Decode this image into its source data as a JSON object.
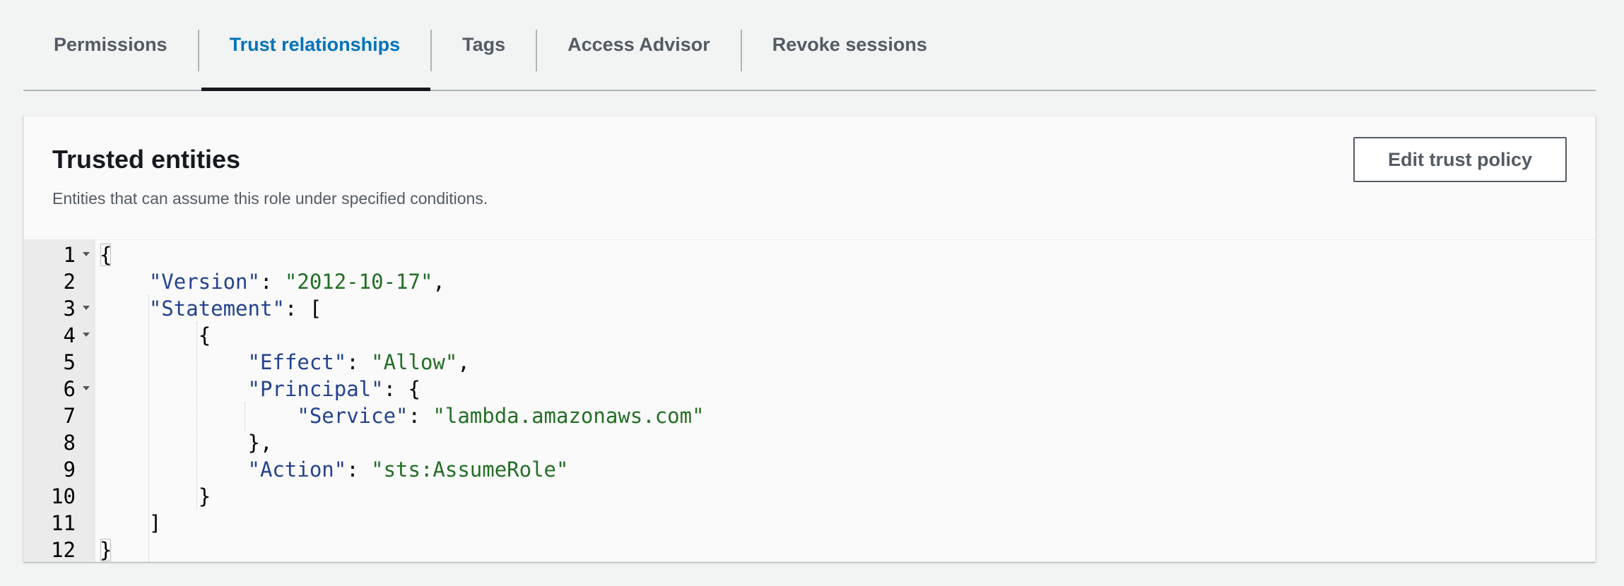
{
  "tabs": [
    {
      "label": "Permissions",
      "active": false
    },
    {
      "label": "Trust relationships",
      "active": true
    },
    {
      "label": "Tags",
      "active": false
    },
    {
      "label": "Access Advisor",
      "active": false
    },
    {
      "label": "Revoke sessions",
      "active": false
    }
  ],
  "panel": {
    "title": "Trusted entities",
    "description": "Entities that can assume this role under specified conditions.",
    "edit_button_label": "Edit trust policy"
  },
  "editor": {
    "lines": [
      {
        "num": "1",
        "fold": true
      },
      {
        "num": "2",
        "fold": false
      },
      {
        "num": "3",
        "fold": true
      },
      {
        "num": "4",
        "fold": true
      },
      {
        "num": "5",
        "fold": false
      },
      {
        "num": "6",
        "fold": true
      },
      {
        "num": "7",
        "fold": false
      },
      {
        "num": "8",
        "fold": false
      },
      {
        "num": "9",
        "fold": false
      },
      {
        "num": "10",
        "fold": false
      },
      {
        "num": "11",
        "fold": false
      },
      {
        "num": "12",
        "fold": false
      }
    ],
    "code": {
      "l1": "{",
      "l2_key": "\"Version\"",
      "l2_val": "\"2012-10-17\"",
      "l3_key": "\"Statement\"",
      "l3_open": "[",
      "l4": "{",
      "l5_key": "\"Effect\"",
      "l5_val": "\"Allow\"",
      "l6_key": "\"Principal\"",
      "l6_open": "{",
      "l7_key": "\"Service\"",
      "l7_val": "\"lambda.amazonaws.com\"",
      "l8": "},",
      "l9_key": "\"Action\"",
      "l9_val": "\"sts:AssumeRole\"",
      "l10": "}",
      "l11": "]",
      "l12": "}"
    }
  },
  "colors": {
    "active_tab": "#0073bb",
    "json_key": "#23428f",
    "json_string": "#236e25"
  }
}
